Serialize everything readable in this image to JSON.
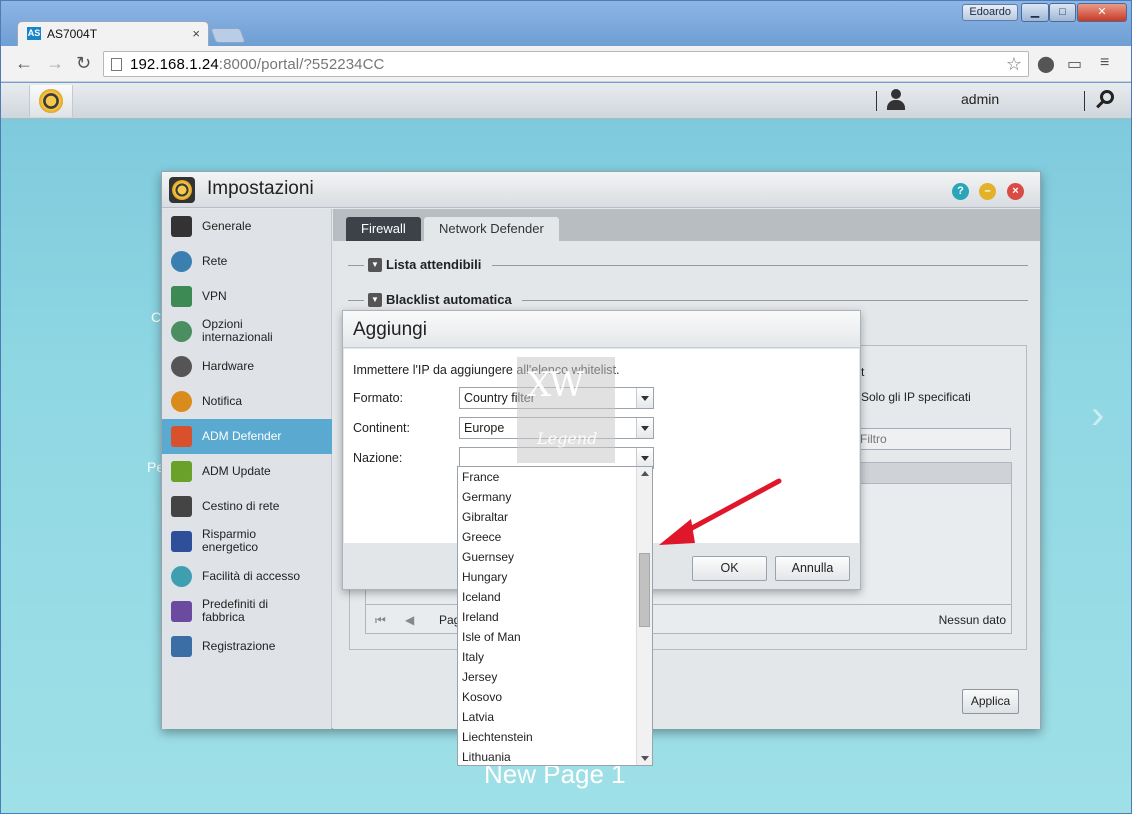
{
  "browser": {
    "user": "Edoardo",
    "tab_title": "AS7004T",
    "favicon": "AS",
    "url_host": "192.168.1.24",
    "url_rest": ":8000/portal/?552234CC"
  },
  "adm": {
    "username": "admin",
    "background_text_left_1": "Pe",
    "background_text_left_2": "C",
    "new_page_label": "New Page 1"
  },
  "settings": {
    "title": "Impostazioni",
    "sidebar": [
      {
        "label": "Generale",
        "icon": "server-icon"
      },
      {
        "label": "Rete",
        "icon": "globe-icon"
      },
      {
        "label": "VPN",
        "icon": "vpn-house-icon"
      },
      {
        "label": "Opzioni internazionali",
        "icon": "international-icon"
      },
      {
        "label": "Hardware",
        "icon": "hardware-icon"
      },
      {
        "label": "Notifica",
        "icon": "notification-icon"
      },
      {
        "label": "ADM Defender",
        "icon": "firewall-icon"
      },
      {
        "label": "ADM Update",
        "icon": "update-arrow-icon"
      },
      {
        "label": "Cestino di rete",
        "icon": "trash-icon"
      },
      {
        "label": "Risparmio energetico",
        "icon": "power-saving-icon"
      },
      {
        "label": "Facilità di accesso",
        "icon": "cloud-upload-icon"
      },
      {
        "label": "Predefiniti di fabbrica",
        "icon": "factory-reset-icon"
      },
      {
        "label": "Registrazione",
        "icon": "registration-icon"
      }
    ],
    "tabs": {
      "firewall": "Firewall",
      "network_defender": "Network Defender"
    },
    "sections": {
      "trusted": "Lista attendibili",
      "auto_blacklist": "Blacklist automatica"
    },
    "panel": {
      "partial_t": "t",
      "only_specified": "Solo gli IP specificati",
      "filter_placeholder": "Filtro",
      "pager_label": "Pag",
      "no_data": "Nessun dato"
    },
    "apply_label": "Applica"
  },
  "dialog": {
    "title": "Aggiungi",
    "instruction": "Immettere l'IP da aggiungere all'elenco whitelist.",
    "format_label": "Formato:",
    "format_value": "Country filter",
    "continent_label": "Continent:",
    "continent_value": "Europe",
    "nation_label": "Nazione:",
    "nation_value": "",
    "ok_label": "OK",
    "cancel_label": "Annulla"
  },
  "watermark": {
    "top": "XW",
    "bottom": "Legend"
  },
  "country_options": [
    "France",
    "Germany",
    "Gibraltar",
    "Greece",
    "Guernsey",
    "Hungary",
    "Iceland",
    "Ireland",
    "Isle of Man",
    "Italy",
    "Jersey",
    "Kosovo",
    "Latvia",
    "Liechtenstein",
    "Lithuania"
  ]
}
